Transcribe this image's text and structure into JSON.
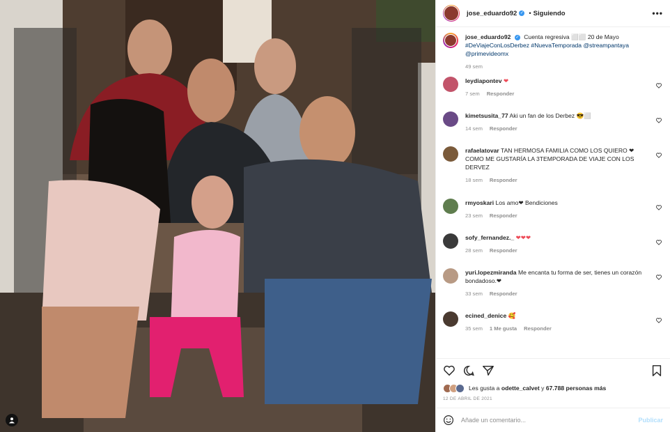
{
  "header": {
    "username": "jose_eduardo92",
    "follow_status": "Siguiendo"
  },
  "caption": {
    "username": "jose_eduardo92",
    "text": "Cuenta regresiva ⬜⬜ 20 de Mayo",
    "hashtags": "#DeViajeConLosDerbez #NuevaTemporada",
    "mention1": "@streampantaya",
    "mention2": "@primevideomx",
    "time": "49 sem"
  },
  "comments": [
    {
      "user": "leydiapontev",
      "text": "❤",
      "time": "7 sem",
      "likes": "",
      "reply": "Responder",
      "color": "#c2546a"
    },
    {
      "user": "kimetsusita_77",
      "text": "Aki un fan de los Derbez 😎⬜",
      "time": "14 sem",
      "likes": "",
      "reply": "Responder",
      "color": "#6a4a86"
    },
    {
      "user": "rafaelatovar",
      "text": "TAN HERMOSA FAMILIA COMO LOS QUIERO ❤ COMO ME GUSTARÍA LA 3TEMPORADA DE VIAJE CON LOS DERVEZ",
      "time": "18 sem",
      "likes": "",
      "reply": "Responder",
      "color": "#7a5a3a"
    },
    {
      "user": "rmyoskari",
      "text": "Los amo❤ Bendiciones",
      "time": "23 sem",
      "likes": "",
      "reply": "Responder",
      "color": "#5f7d4e"
    },
    {
      "user": "sofy_fernandez._",
      "text": "❤❤❤",
      "time": "28 sem",
      "likes": "",
      "reply": "Responder",
      "color": "#3a3a3a"
    },
    {
      "user": "yuri.lopezmiranda",
      "text": "Me encanta tu forma de ser, tienes un corazón bondadoso.❤",
      "time": "33 sem",
      "likes": "",
      "reply": "Responder",
      "color": "#b89a84"
    },
    {
      "user": "ecined_denice",
      "text": "🥰",
      "time": "35 sem",
      "likes": "1 Me gusta",
      "reply": "Responder",
      "color": "#4a3a30"
    }
  ],
  "likes": {
    "prefix": "Les gusta a",
    "user": "odette_calvet",
    "middle": "y",
    "count": "67.788 personas más"
  },
  "date": "12 DE ABRIL DE 2021",
  "add_comment": {
    "placeholder": "Añade un comentario...",
    "publish": "Publicar"
  },
  "icons": {
    "like": "heart-icon",
    "comment": "comment-icon",
    "share": "share-icon",
    "save": "bookmark-icon",
    "emoji": "emoji-icon",
    "more": "more-icon",
    "user_tag": "user-tag-icon"
  },
  "colors": {
    "verified": "#3897f0",
    "link": "#00376b",
    "heart": "#ed4956",
    "publish": "#b2dffc"
  }
}
